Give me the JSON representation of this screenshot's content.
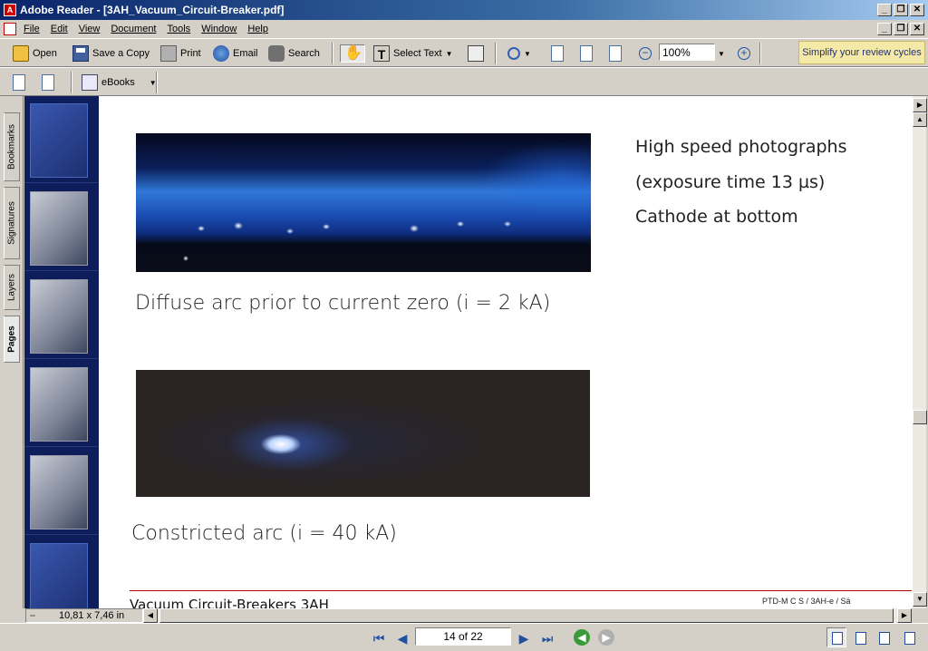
{
  "window": {
    "title": "Adobe Reader - [3AH_Vacuum_Circuit-Breaker.pdf]",
    "controls": [
      "_",
      "❐",
      "✕"
    ]
  },
  "menu": [
    "File",
    "Edit",
    "View",
    "Document",
    "Tools",
    "Window",
    "Help"
  ],
  "toolbar": {
    "open": "Open",
    "save_copy": "Save a Copy",
    "print": "Print",
    "email": "Email",
    "search": "Search",
    "select_text": "Select Text",
    "zoom": "100%",
    "promo": "Simplify your review cycles",
    "ebooks": "eBooks"
  },
  "sidetabs": [
    "Bookmarks",
    "Signatures",
    "Layers",
    "Pages"
  ],
  "document": {
    "side_lines": [
      "High speed photographs",
      "(exposure time 13 µs)",
      "Cathode at bottom"
    ],
    "caption1": "Diffuse arc prior to current zero (i = 2 kA)",
    "caption2": "Constricted arc (i = 40 kA)",
    "footer_title": "Vacuum Circuit-Breakers 3AH",
    "footer_code": "PTD-M C S / 3AH-e / Sä"
  },
  "status": {
    "page_size": "10,81 x 7,46 in",
    "page_indicator": "14 of 22"
  }
}
